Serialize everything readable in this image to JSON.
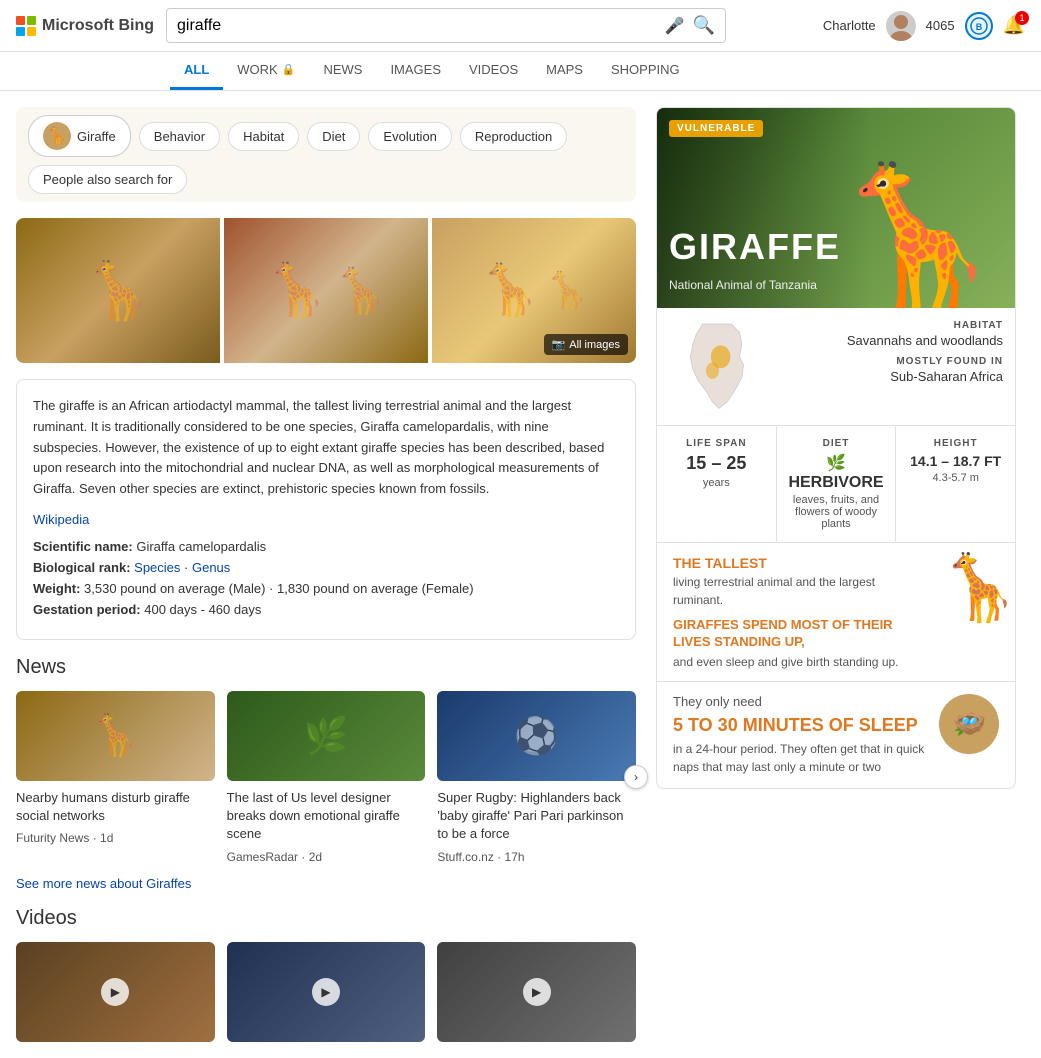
{
  "header": {
    "brand": "Microsoft Bing",
    "search_query": "giraffe",
    "user_name": "Charlotte",
    "user_score": "4065",
    "notif_count": "1"
  },
  "nav": {
    "items": [
      {
        "id": "all",
        "label": "ALL",
        "active": true,
        "has_lock": false
      },
      {
        "id": "work",
        "label": "WORK",
        "active": false,
        "has_lock": true
      },
      {
        "id": "news",
        "label": "NEWS",
        "active": false,
        "has_lock": false
      },
      {
        "id": "images",
        "label": "IMAGES",
        "active": false,
        "has_lock": false
      },
      {
        "id": "videos",
        "label": "VIDEOS",
        "active": false,
        "has_lock": false
      },
      {
        "id": "maps",
        "label": "MAPS",
        "active": false,
        "has_lock": false
      },
      {
        "id": "shopping",
        "label": "SHOPPING",
        "active": false,
        "has_lock": false
      }
    ]
  },
  "filter_pills": [
    {
      "id": "giraffe",
      "label": "Giraffe",
      "has_icon": true,
      "active": true
    },
    {
      "id": "behavior",
      "label": "Behavior",
      "has_icon": false
    },
    {
      "id": "habitat",
      "label": "Habitat",
      "has_icon": false
    },
    {
      "id": "diet",
      "label": "Diet",
      "has_icon": false
    },
    {
      "id": "evolution",
      "label": "Evolution",
      "has_icon": false
    },
    {
      "id": "reproduction",
      "label": "Reproduction",
      "has_icon": false
    },
    {
      "id": "people_also",
      "label": "People also search for",
      "has_icon": false
    }
  ],
  "all_images_label": "All images",
  "info": {
    "description": "The giraffe is an African artiodactyl mammal, the tallest living terrestrial animal and the largest ruminant. It is traditionally considered to be one species, Giraffa camelopardalis, with nine subspecies. However, the existence of up to eight extant giraffe species has been described, based upon research into the mitochondrial and nuclear DNA, as well as morphological measurements of Giraffa. Seven other species are extinct, prehistoric species known from fossils.",
    "wiki_label": "Wikipedia",
    "scientific_name_label": "Scientific name:",
    "scientific_name_value": "Giraffa camelopardalis",
    "bio_rank_label": "Biological rank:",
    "bio_rank_species": "Species",
    "bio_rank_separator": " · ",
    "bio_rank_genus": "Genus",
    "weight_label": "Weight:",
    "weight_value": "3,530 pound on average (Male) · 1,830 pound on average (Female)",
    "gestation_label": "Gestation period:",
    "gestation_value": "400 days - 460 days"
  },
  "news": {
    "section_title": "News",
    "cards": [
      {
        "title": "Nearby humans disturb giraffe social networks",
        "source": "Futurity News",
        "time": "1d"
      },
      {
        "title": "The last of Us level designer breaks down emotional giraffe scene",
        "source": "GamesRadar",
        "time": "2d"
      },
      {
        "title": "Super Rugby: Highlanders back 'baby giraffe' Pari Pari parkinson to be a force",
        "source": "Stuff.co.nz",
        "time": "17h"
      }
    ],
    "see_more_label": "See more news about Giraffes"
  },
  "videos": {
    "section_title": "Videos"
  },
  "knowledge_card": {
    "vulnerable_label": "VULNERABLE",
    "title": "GIRAFFE",
    "subtitle": "National Animal of Tanzania",
    "habitat_label": "HABITAT",
    "habitat_value": "Savannahs and woodlands",
    "mostly_found_label": "MOSTLY FOUND IN",
    "mostly_found_value": "Sub-Saharan Africa",
    "lifespan_label": "LIFE SPAN",
    "lifespan_value": "15 – 25",
    "lifespan_unit": "years",
    "diet_label": "DIET",
    "diet_value": "HERBIVORE",
    "diet_desc": "leaves, fruits, and flowers of woody plants",
    "height_label": "HEIGHT",
    "height_value": "14.1 – 18.7 FT",
    "height_unit": "4.3-5.7 m",
    "tallest_label": "THE TALLEST",
    "tallest_desc": "living terrestrial animal and the largest ruminant.",
    "standing_label": "GIRAFFES SPEND MOST OF THEIR LIVES STANDING UP,",
    "standing_desc": "and even sleep and give birth standing up.",
    "sleep_intro": "They only need",
    "sleep_highlight": "5 TO 30 MINUTES OF SLEEP",
    "sleep_desc": "in a 24-hour period. They often get that in quick naps that may last only a minute or two"
  }
}
